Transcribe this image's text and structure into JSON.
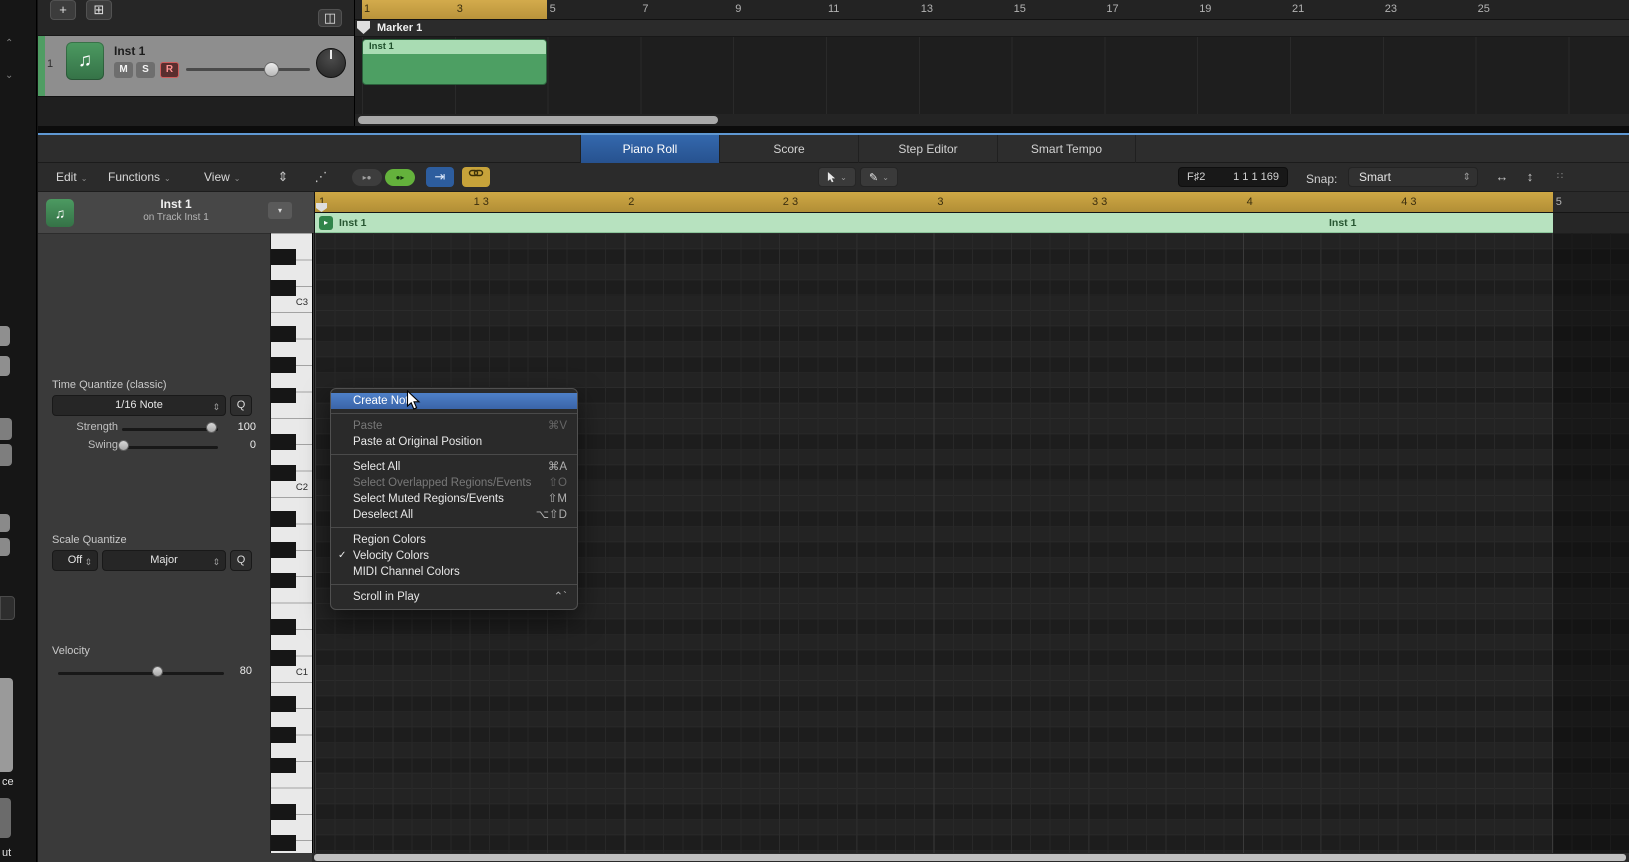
{
  "icons": {
    "plus": "+",
    "new_track": "⊞",
    "display_mode": "◫",
    "chevron_down": "⌄",
    "collapse": "⇕",
    "automation": "⋰",
    "midi_in": "▸●",
    "midi_out": "●▸",
    "catch": "⇥",
    "pencil": "✎",
    "stepper": "⇕",
    "zoom_h": "↔",
    "zoom_v": "↕",
    "dots": "∷",
    "region_play": "▸",
    "menu_box": "▾",
    "music_note": "♫"
  },
  "arrange": {
    "toolbar": {
      "add_label": "+"
    },
    "track": {
      "number": "1",
      "name": "Inst 1",
      "mute_label": "M",
      "solo_label": "S",
      "record_label": "R"
    },
    "ruler": {
      "ticks": [
        "1",
        "3",
        "5",
        "7",
        "9",
        "11",
        "13",
        "15",
        "17",
        "19",
        "21",
        "23",
        "25"
      ]
    },
    "marker_name": "Marker 1",
    "region_name": "Inst 1"
  },
  "editor_tabs": {
    "items": [
      "Piano Roll",
      "Score",
      "Step Editor",
      "Smart Tempo"
    ],
    "active": "Piano Roll"
  },
  "toolbar": {
    "menus": {
      "edit": "Edit",
      "functions": "Functions",
      "view": "View"
    },
    "note_display": "F♯2",
    "position_display": "1 1 1 169",
    "snap_label": "Snap:",
    "snap_value": "Smart"
  },
  "inspector": {
    "title": "Inst 1",
    "subtitle": "on Track Inst 1",
    "time_quantize": {
      "label": "Time Quantize (classic)",
      "value": "1/16 Note",
      "q": "Q",
      "strength_label": "Strength",
      "strength_value": "100",
      "swing_label": "Swing",
      "swing_value": "0"
    },
    "scale_quantize": {
      "label": "Scale Quantize",
      "off_value": "Off",
      "scale_value": "Major",
      "q": "Q"
    },
    "velocity": {
      "label": "Velocity",
      "value": "80"
    }
  },
  "piano_roll": {
    "ruler_ticks": [
      "1",
      "1 3",
      "2",
      "2 3",
      "3",
      "3 3",
      "4",
      "4 3",
      "5"
    ],
    "region_label_left": "Inst 1",
    "region_label_right": "Inst 1",
    "key_labels": [
      "C3",
      "C2",
      "C1"
    ]
  },
  "context_menu": {
    "checkmark": "✓",
    "items": [
      {
        "label": "Create Note",
        "shortcut": "",
        "state": "highlighted"
      },
      {
        "label": "Paste",
        "shortcut": "⌘V",
        "state": "disabled"
      },
      {
        "label": "Paste at Original Position",
        "shortcut": "",
        "state": "normal"
      },
      {
        "label": "Select All",
        "shortcut": "⌘A",
        "state": "normal"
      },
      {
        "label": "Select Overlapped Regions/Events",
        "shortcut": "⇧O",
        "state": "disabled"
      },
      {
        "label": "Select Muted Regions/Events",
        "shortcut": "⇧M",
        "state": "normal"
      },
      {
        "label": "Deselect All",
        "shortcut": "⌥⇧D",
        "state": "normal"
      },
      {
        "label": "Region Colors",
        "shortcut": "",
        "state": "normal"
      },
      {
        "label": "Velocity Colors",
        "shortcut": "",
        "state": "checked"
      },
      {
        "label": "MIDI Channel Colors",
        "shortcut": "",
        "state": "normal"
      },
      {
        "label": "Scroll in Play",
        "shortcut": "⌃`",
        "state": "normal"
      }
    ]
  },
  "edge": {
    "frag_a": "ce",
    "frag_b": "ut"
  },
  "colors": {
    "accent_blue": "#2d5c9e",
    "cycle_gold": "#c49c3e",
    "region_green": "#4d9f63",
    "region_header_green": "#abdcb4",
    "midi_out_green": "#64b23c",
    "link_yellow": "#c7a33a",
    "record_red": "#cf5b5b",
    "menu_highlight": "#3f6cb0"
  }
}
